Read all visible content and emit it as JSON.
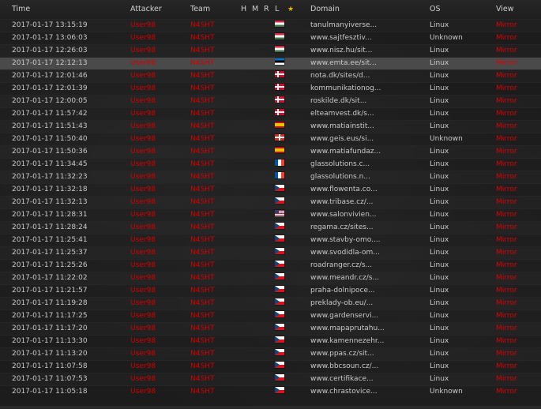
{
  "header": {
    "time": "Time",
    "attacker": "Attacker",
    "team": "Team",
    "h": "H",
    "m": "M",
    "r": "R",
    "l": "L",
    "star": "★",
    "domain": "Domain",
    "os": "OS",
    "view": "View"
  },
  "colors": {
    "attacker": "#d40000",
    "mirror": "#e00000",
    "star": "#e6b800",
    "highlight_row": "#4a4a4a"
  },
  "highlighted_row_index": 3,
  "rows": [
    {
      "time": "2017-01-17 13:15:19",
      "attacker": "User98",
      "team": "N4SHT",
      "flag": "hu",
      "domain": "tanulmanyiverse...",
      "os": "Linux",
      "view": "Mirror"
    },
    {
      "time": "2017-01-17 13:06:03",
      "attacker": "User98",
      "team": "N4SHT",
      "flag": "hu",
      "domain": "www.sajtfesztiv...",
      "os": "Unknown",
      "view": "Mirror"
    },
    {
      "time": "2017-01-17 12:26:03",
      "attacker": "User98",
      "team": "N4SHT",
      "flag": "hu",
      "domain": "www.nisz.hu/sit...",
      "os": "Linux",
      "view": "Mirror"
    },
    {
      "time": "2017-01-17 12:12:13",
      "attacker": "User98",
      "team": "N4SHT",
      "flag": "ee",
      "domain": "www.emta.ee/sit...",
      "os": "Linux",
      "view": "Mirror"
    },
    {
      "time": "2017-01-17 12:01:46",
      "attacker": "User98",
      "team": "N4SHT",
      "flag": "dk",
      "domain": "nota.dk/sites/d...",
      "os": "Linux",
      "view": "Mirror"
    },
    {
      "time": "2017-01-17 12:01:39",
      "attacker": "User98",
      "team": "N4SHT",
      "flag": "dk",
      "domain": "kommunikationog...",
      "os": "Linux",
      "view": "Mirror"
    },
    {
      "time": "2017-01-17 12:00:05",
      "attacker": "User98",
      "team": "N4SHT",
      "flag": "dk",
      "domain": "roskilde.dk/sit...",
      "os": "Linux",
      "view": "Mirror"
    },
    {
      "time": "2017-01-17 11:57:42",
      "attacker": "User98",
      "team": "N4SHT",
      "flag": "dk",
      "domain": "elteamvest.dk/s...",
      "os": "Linux",
      "view": "Mirror"
    },
    {
      "time": "2017-01-17 11:51:43",
      "attacker": "User98",
      "team": "N4SHT",
      "flag": "es",
      "domain": "www.matiainstit...",
      "os": "Linux",
      "view": "Mirror"
    },
    {
      "time": "2017-01-17 11:50:40",
      "attacker": "User98",
      "team": "N4SHT",
      "flag": "ch",
      "domain": "www.geis.eus/si...",
      "os": "Unknown",
      "view": "Mirror"
    },
    {
      "time": "2017-01-17 11:50:36",
      "attacker": "User98",
      "team": "N4SHT",
      "flag": "es",
      "domain": "www.matiafundaz...",
      "os": "Linux",
      "view": "Mirror"
    },
    {
      "time": "2017-01-17 11:34:45",
      "attacker": "User98",
      "team": "N4SHT",
      "flag": "fr",
      "domain": "glassolutions.c...",
      "os": "Linux",
      "view": "Mirror"
    },
    {
      "time": "2017-01-17 11:32:23",
      "attacker": "User98",
      "team": "N4SHT",
      "flag": "fr",
      "domain": "glassolutions.n...",
      "os": "Linux",
      "view": "Mirror"
    },
    {
      "time": "2017-01-17 11:32:18",
      "attacker": "User98",
      "team": "N4SHT",
      "flag": "cz",
      "domain": "www.flowenta.co...",
      "os": "Linux",
      "view": "Mirror"
    },
    {
      "time": "2017-01-17 11:32:13",
      "attacker": "User98",
      "team": "N4SHT",
      "flag": "cz",
      "domain": "www.tribase.cz/...",
      "os": "Linux",
      "view": "Mirror"
    },
    {
      "time": "2017-01-17 11:28:31",
      "attacker": "User98",
      "team": "N4SHT",
      "flag": "us",
      "domain": "www.salonvivien...",
      "os": "Linux",
      "view": "Mirror"
    },
    {
      "time": "2017-01-17 11:28:24",
      "attacker": "User98",
      "team": "N4SHT",
      "flag": "cz",
      "domain": "regama.cz/sites...",
      "os": "Linux",
      "view": "Mirror"
    },
    {
      "time": "2017-01-17 11:25:41",
      "attacker": "User98",
      "team": "N4SHT",
      "flag": "cz",
      "domain": "www.stavby-omo....",
      "os": "Linux",
      "view": "Mirror"
    },
    {
      "time": "2017-01-17 11:25:37",
      "attacker": "User98",
      "team": "N4SHT",
      "flag": "cz",
      "domain": "www.svodidla-om...",
      "os": "Linux",
      "view": "Mirror"
    },
    {
      "time": "2017-01-17 11:25:26",
      "attacker": "User98",
      "team": "N4SHT",
      "flag": "cz",
      "domain": "roadranger.cz/s...",
      "os": "Linux",
      "view": "Mirror"
    },
    {
      "time": "2017-01-17 11:22:02",
      "attacker": "User98",
      "team": "N4SHT",
      "flag": "cz",
      "domain": "www.meandr.cz/s...",
      "os": "Linux",
      "view": "Mirror"
    },
    {
      "time": "2017-01-17 11:21:57",
      "attacker": "User98",
      "team": "N4SHT",
      "flag": "cz",
      "domain": "praha-dolnipoce...",
      "os": "Linux",
      "view": "Mirror"
    },
    {
      "time": "2017-01-17 11:19:28",
      "attacker": "User98",
      "team": "N4SHT",
      "flag": "cz",
      "domain": "preklady-ob.eu/...",
      "os": "Linux",
      "view": "Mirror"
    },
    {
      "time": "2017-01-17 11:17:25",
      "attacker": "User98",
      "team": "N4SHT",
      "flag": "cz",
      "domain": "www.gardenservi...",
      "os": "Linux",
      "view": "Mirror"
    },
    {
      "time": "2017-01-17 11:17:20",
      "attacker": "User98",
      "team": "N4SHT",
      "flag": "cz",
      "domain": "www.mapaprutahu...",
      "os": "Linux",
      "view": "Mirror"
    },
    {
      "time": "2017-01-17 11:13:30",
      "attacker": "User98",
      "team": "N4SHT",
      "flag": "cz",
      "domain": "www.kamennezehr...",
      "os": "Linux",
      "view": "Mirror"
    },
    {
      "time": "2017-01-17 11:13:20",
      "attacker": "User98",
      "team": "N4SHT",
      "flag": "cz",
      "domain": "www.ppas.cz/sit...",
      "os": "Linux",
      "view": "Mirror"
    },
    {
      "time": "2017-01-17 11:07:58",
      "attacker": "User98",
      "team": "N4SHT",
      "flag": "cz",
      "domain": "www.bbcsoun.cz/...",
      "os": "Linux",
      "view": "Mirror"
    },
    {
      "time": "2017-01-17 11:07:53",
      "attacker": "User98",
      "team": "N4SHT",
      "flag": "cz",
      "domain": "www.certifikace...",
      "os": "Linux",
      "view": "Mirror"
    },
    {
      "time": "2017-01-17 11:05:18",
      "attacker": "User98",
      "team": "N4SHT",
      "flag": "cz",
      "domain": "www.chrastovice...",
      "os": "Unknown",
      "view": "Mirror"
    }
  ]
}
